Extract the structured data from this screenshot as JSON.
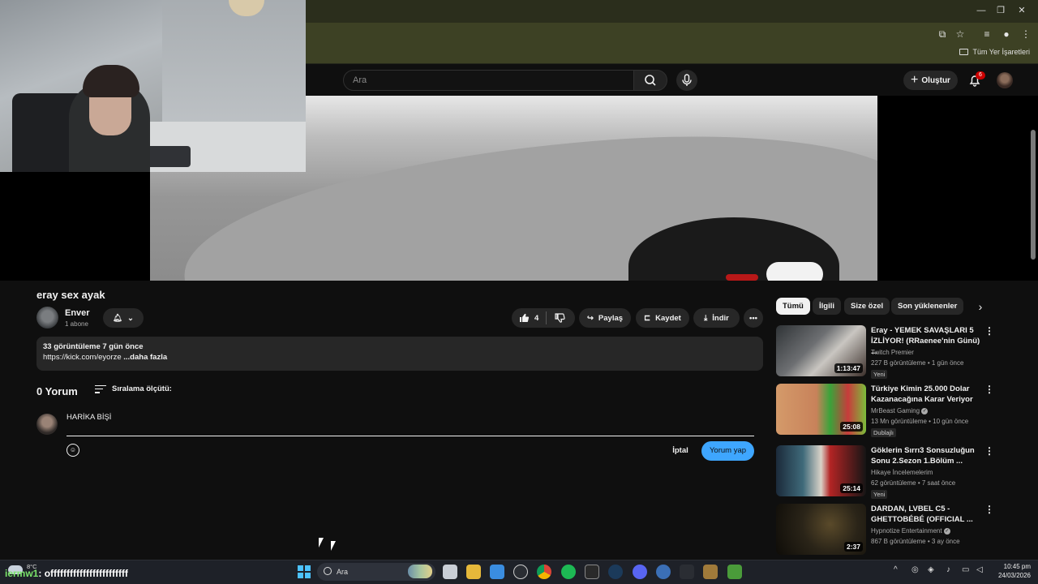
{
  "browser": {
    "bookmarks_all": "Tüm Yer İşaretleri"
  },
  "header": {
    "search_placeholder": "Ara",
    "create_label": "Oluştur",
    "notifications_count": "6"
  },
  "video": {
    "title": "eray sex ayak",
    "channel_name": "Enver",
    "subscribers": "1 abone",
    "likes": "4",
    "share_label": "Paylaş",
    "save_label": "Kaydet",
    "download_label": "İndir",
    "views_date": "33 görüntüleme  7 gün önce",
    "description_link": "https://kick.com/eyorze",
    "description_more": "...daha fazla"
  },
  "comments": {
    "count_label": "0 Yorum",
    "sort_label": "Sıralama ölçütü:",
    "draft_text": "HARİKA BİŞİ",
    "cancel_label": "İptal",
    "submit_label": "Yorum yap"
  },
  "sidebar": {
    "chips": [
      {
        "label": "Tümü",
        "active": true
      },
      {
        "label": "İlgili",
        "active": false
      },
      {
        "label": "Size özel",
        "active": false
      },
      {
        "label": "Son yüklenenler",
        "active": false
      }
    ],
    "recommendations": [
      {
        "title": "Eray - YEMEK SAVAŞLARI 5 İZLİYOR! (RRaenee'nin Günü) ...",
        "channel": "Twitch Premier",
        "verified": false,
        "meta": "227 B görüntüleme • 1 gün önce",
        "badge": "Yeni",
        "duration": "1:13:47"
      },
      {
        "title": "Türkiye Kimin 25.000 Dolar Kazanacağına Karar Veriyor",
        "channel": "MrBeast Gaming",
        "verified": true,
        "meta": "13 Mn görüntüleme • 10 gün önce",
        "badge": "Dublajlı",
        "duration": "25:08"
      },
      {
        "title": "Göklerin Sırrı3 Sonsuzluğun Sonu 2.Sezon 1.Bölüm ...",
        "channel": "Hikaye İncelemelerim",
        "verified": false,
        "meta": "62 görüntüleme • 7 saat önce",
        "badge": "Yeni",
        "duration": "25:14"
      },
      {
        "title": "DARDAN, LVBEL C5 - GHETTOBÉBÉ (OFFICIAL ...",
        "channel": "Hypnotize Entertainment",
        "verified": true,
        "meta": "867 B görüntüleme • 3 ay önce",
        "badge": "",
        "duration": "2:37"
      }
    ]
  },
  "taskbar": {
    "weather_temp": "8°C",
    "overlay_prefix": "iermw1",
    "overlay_text": ": offffffffffffffffffffffff",
    "search_label": "Ara",
    "time": "10:45 pm",
    "date": "24/03/2026"
  },
  "colors": {
    "accent": "#3ea6ff",
    "background": "#0f0f0f",
    "chrome": "#3d4124",
    "badge": "#cc0000"
  }
}
